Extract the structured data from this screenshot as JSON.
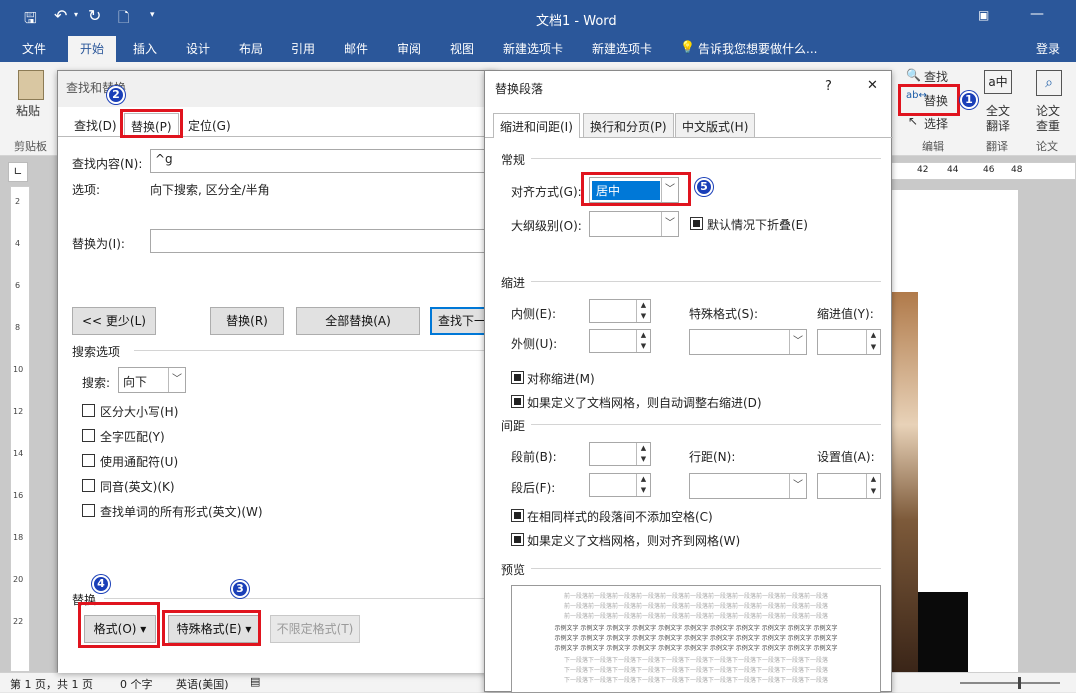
{
  "window": {
    "title": "文档1 - Word",
    "login": "登录"
  },
  "ribbon_tabs": [
    "文件",
    "开始",
    "插入",
    "设计",
    "布局",
    "引用",
    "邮件",
    "审阅",
    "视图",
    "新建选项卡",
    "新建选项卡"
  ],
  "tell_me": "告诉我您想要做什么...",
  "ribbon": {
    "paste": "粘贴",
    "clipboard": "剪贴板",
    "find": "查找",
    "replace": "替换",
    "select": "选择",
    "edit_group": "编辑",
    "fulltext_translate_1": "全文",
    "fulltext_translate_2": "翻译",
    "translate_group": "翻译",
    "paper_check_1": "论文",
    "paper_check_2": "查重",
    "paper_group": "论文"
  },
  "ruler_numbers": [
    "42",
    "44",
    "46",
    "48"
  ],
  "vruler_numbers": [
    "2",
    "4",
    "6",
    "8",
    "10",
    "12",
    "14",
    "16",
    "18",
    "20",
    "22"
  ],
  "find_dialog": {
    "title": "查找和替换",
    "tabs": [
      "查找(D)",
      "替换(P)",
      "定位(G)"
    ],
    "find_label": "查找内容(N):",
    "find_value": "^g",
    "options_label": "选项:",
    "options_value": "向下搜索, 区分全/半角",
    "replace_label": "替换为(I):",
    "replace_value": "",
    "less_button": "<< 更少(L)",
    "replace_button": "替换(R)",
    "replace_all_button": "全部替换(A)",
    "find_next_button": "查找下一",
    "search_options": "搜索选项",
    "search_label": "搜索:",
    "search_value": "向下",
    "checkboxes": [
      "区分大小写(H)",
      "全字匹配(Y)",
      "使用通配符(U)",
      "同音(英文)(K)",
      "查找单词的所有形式(英文)(W)"
    ],
    "replace_section": "替换",
    "format_button": "格式(O) ▾",
    "special_button": "特殊格式(E) ▾",
    "no_format_button": "不限定格式(T)"
  },
  "para_dialog": {
    "title": "替换段落",
    "help": "?",
    "close": "✕",
    "tabs": [
      "缩进和间距(I)",
      "换行和分页(P)",
      "中文版式(H)"
    ],
    "general": "常规",
    "align_label": "对齐方式(G):",
    "align_value": "居中",
    "outline_label": "大纲级别(O):",
    "outline_value": "",
    "collapse_label": "默认情况下折叠(E)",
    "indent": "缩进",
    "inner_label": "内侧(E):",
    "outer_label": "外侧(U):",
    "special_label": "特殊格式(S):",
    "indent_value_label": "缩进值(Y):",
    "mirror_indent": "对称缩进(M)",
    "auto_adjust_right": "如果定义了文档网格，则自动调整右缩进(D)",
    "spacing": "间距",
    "before_label": "段前(B):",
    "after_label": "段后(F):",
    "line_spacing_label": "行距(N):",
    "set_value_label": "设置值(A):",
    "no_space_same_style": "在相同样式的段落间不添加空格(C)",
    "snap_to_grid": "如果定义了文档网格，则对齐到网格(W)",
    "preview": "预览",
    "preview_prev": "前一段落前一段落前一段落前一段落前一段落前一段落前一段落前一段落前一段落前一段落前一段落",
    "preview_sample": "示例文字 示例文字 示例文字 示例文字 示例文字 示例文字 示例文字 示例文字 示例文字 示例文字 示例文字",
    "preview_next": "下一段落下一段落下一段落下一段落下一段落下一段落下一段落下一段落下一段落下一段落下一段落"
  },
  "badges": [
    "1",
    "2",
    "3",
    "4",
    "5"
  ],
  "status": {
    "page": "第 1 页，共 1 页",
    "words": "0 个字",
    "language": "英语(美国)"
  }
}
